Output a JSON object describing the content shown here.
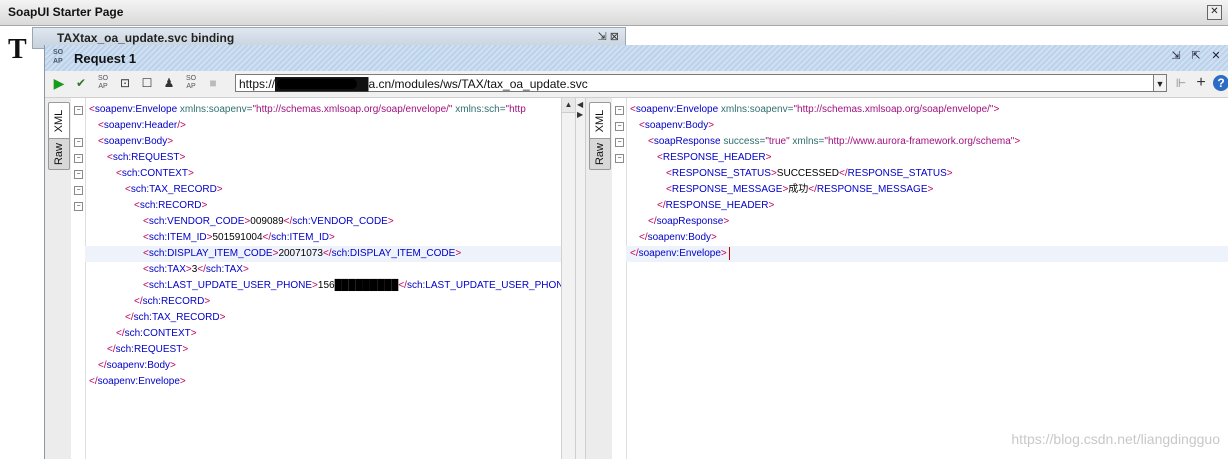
{
  "starter": {
    "title": "SoapUI Starter Page",
    "close": "✕",
    "heading_letter": "T"
  },
  "behind_window": {
    "title": "TAXtax_oa_update.svc binding"
  },
  "request": {
    "title": "Request 1",
    "logo_top": "SO",
    "logo_bottom": "AP",
    "url": "https://███████████a.cn/modules/ws/TAX/tax_oa_update.svc"
  },
  "left_tabs": {
    "xml": "XML",
    "raw": "Raw"
  },
  "right_tabs": {
    "xml": "XML",
    "raw": "Raw"
  },
  "request_lines": [
    {
      "indent": 0,
      "fold": true,
      "parts": [
        [
          "br",
          "<"
        ],
        [
          "tag",
          "soapenv:Envelope"
        ],
        [
          "attr",
          " xmlns:soapenv="
        ],
        [
          "val",
          "\"http://schemas.xmlsoap.org/soap/envelope/\""
        ],
        [
          "attr",
          " xmlns:sch="
        ],
        [
          "val",
          "\"http"
        ]
      ]
    },
    {
      "indent": 1,
      "fold": false,
      "parts": [
        [
          "br",
          "<"
        ],
        [
          "tag",
          "soapenv:Header"
        ],
        [
          "br",
          "/>"
        ]
      ]
    },
    {
      "indent": 1,
      "fold": true,
      "parts": [
        [
          "br",
          "<"
        ],
        [
          "tag",
          "soapenv:Body"
        ],
        [
          "br",
          ">"
        ]
      ]
    },
    {
      "indent": 2,
      "fold": true,
      "parts": [
        [
          "br",
          "<"
        ],
        [
          "tag",
          "sch:REQUEST"
        ],
        [
          "br",
          ">"
        ]
      ]
    },
    {
      "indent": 3,
      "fold": true,
      "parts": [
        [
          "br",
          "<"
        ],
        [
          "tag",
          "sch:CONTEXT"
        ],
        [
          "br",
          ">"
        ]
      ]
    },
    {
      "indent": 4,
      "fold": true,
      "parts": [
        [
          "br",
          "<"
        ],
        [
          "tag",
          "sch:TAX_RECORD"
        ],
        [
          "br",
          ">"
        ]
      ]
    },
    {
      "indent": 5,
      "fold": true,
      "parts": [
        [
          "br",
          "<"
        ],
        [
          "tag",
          "sch:RECORD"
        ],
        [
          "br",
          ">"
        ]
      ]
    },
    {
      "indent": 6,
      "fold": false,
      "parts": [
        [
          "br",
          "<"
        ],
        [
          "tag",
          "sch:VENDOR_CODE"
        ],
        [
          "br",
          ">"
        ],
        [
          "txt",
          "009089"
        ],
        [
          "br",
          "</"
        ],
        [
          "tag",
          "sch:VENDOR_CODE"
        ],
        [
          "br",
          ">"
        ]
      ]
    },
    {
      "indent": 6,
      "fold": false,
      "parts": [
        [
          "br",
          "<"
        ],
        [
          "tag",
          "sch:ITEM_ID"
        ],
        [
          "br",
          ">"
        ],
        [
          "txt",
          "501591004"
        ],
        [
          "br",
          "</"
        ],
        [
          "tag",
          "sch:ITEM_ID"
        ],
        [
          "br",
          ">"
        ]
      ]
    },
    {
      "indent": 6,
      "fold": false,
      "hl": true,
      "parts": [
        [
          "br",
          "<"
        ],
        [
          "tag",
          "sch:DISPLAY_ITEM_CODE"
        ],
        [
          "br",
          ">"
        ],
        [
          "txt",
          "20071073"
        ],
        [
          "br",
          "</"
        ],
        [
          "tag",
          "sch:DISPLAY_ITEM_CODE"
        ],
        [
          "br",
          ">"
        ]
      ]
    },
    {
      "indent": 6,
      "fold": false,
      "parts": [
        [
          "br",
          "<"
        ],
        [
          "tag",
          "sch:TAX"
        ],
        [
          "br",
          ">"
        ],
        [
          "txt",
          "3"
        ],
        [
          "br",
          "</"
        ],
        [
          "tag",
          "sch:TAX"
        ],
        [
          "br",
          ">"
        ]
      ]
    },
    {
      "indent": 6,
      "fold": false,
      "parts": [
        [
          "br",
          "<"
        ],
        [
          "tag",
          "sch:LAST_UPDATE_USER_PHONE"
        ],
        [
          "br",
          ">"
        ],
        [
          "txt",
          "156█████████"
        ],
        [
          "br",
          "</"
        ],
        [
          "tag",
          "sch:LAST_UPDATE_USER_PHONE"
        ],
        [
          "br",
          ">"
        ]
      ]
    },
    {
      "indent": 5,
      "fold": false,
      "parts": [
        [
          "br",
          "</"
        ],
        [
          "tag",
          "sch:RECORD"
        ],
        [
          "br",
          ">"
        ]
      ]
    },
    {
      "indent": 4,
      "fold": false,
      "parts": [
        [
          "br",
          "</"
        ],
        [
          "tag",
          "sch:TAX_RECORD"
        ],
        [
          "br",
          ">"
        ]
      ]
    },
    {
      "indent": 3,
      "fold": false,
      "parts": [
        [
          "br",
          "</"
        ],
        [
          "tag",
          "sch:CONTEXT"
        ],
        [
          "br",
          ">"
        ]
      ]
    },
    {
      "indent": 2,
      "fold": false,
      "parts": [
        [
          "br",
          "</"
        ],
        [
          "tag",
          "sch:REQUEST"
        ],
        [
          "br",
          ">"
        ]
      ]
    },
    {
      "indent": 1,
      "fold": false,
      "parts": [
        [
          "br",
          "</"
        ],
        [
          "tag",
          "soapenv:Body"
        ],
        [
          "br",
          ">"
        ]
      ]
    },
    {
      "indent": 0,
      "fold": false,
      "parts": [
        [
          "br",
          "</"
        ],
        [
          "tag",
          "soapenv:Envelope"
        ],
        [
          "br",
          ">"
        ]
      ]
    }
  ],
  "response_lines": [
    {
      "indent": 0,
      "fold": true,
      "parts": [
        [
          "br",
          "<"
        ],
        [
          "tag",
          "soapenv:Envelope"
        ],
        [
          "attr",
          " xmlns:soapenv="
        ],
        [
          "val",
          "\"http://schemas.xmlsoap.org/soap/envelope/\""
        ],
        [
          "br",
          ">"
        ]
      ]
    },
    {
      "indent": 1,
      "fold": true,
      "parts": [
        [
          "br",
          "<"
        ],
        [
          "tag",
          "soapenv:Body"
        ],
        [
          "br",
          ">"
        ]
      ]
    },
    {
      "indent": 2,
      "fold": true,
      "parts": [
        [
          "br",
          "<"
        ],
        [
          "tag",
          "soapResponse"
        ],
        [
          "attr",
          " success="
        ],
        [
          "val",
          "\"true\""
        ],
        [
          "attr",
          " xmlns="
        ],
        [
          "val",
          "\"http://www.aurora-framework.org/schema\""
        ],
        [
          "br",
          ">"
        ]
      ]
    },
    {
      "indent": 3,
      "fold": true,
      "parts": [
        [
          "br",
          "<"
        ],
        [
          "tag",
          "RESPONSE_HEADER"
        ],
        [
          "br",
          ">"
        ]
      ]
    },
    {
      "indent": 4,
      "fold": false,
      "parts": [
        [
          "br",
          "<"
        ],
        [
          "tag",
          "RESPONSE_STATUS"
        ],
        [
          "br",
          ">"
        ],
        [
          "txt",
          "SUCCESSED"
        ],
        [
          "br",
          "</"
        ],
        [
          "tag",
          "RESPONSE_STATUS"
        ],
        [
          "br",
          ">"
        ]
      ]
    },
    {
      "indent": 4,
      "fold": false,
      "parts": [
        [
          "br",
          "<"
        ],
        [
          "tag",
          "RESPONSE_MESSAGE"
        ],
        [
          "br",
          ">"
        ],
        [
          "txt",
          "成功"
        ],
        [
          "br",
          "</"
        ],
        [
          "tag",
          "RESPONSE_MESSAGE"
        ],
        [
          "br",
          ">"
        ]
      ]
    },
    {
      "indent": 3,
      "fold": false,
      "parts": [
        [
          "br",
          "</"
        ],
        [
          "tag",
          "RESPONSE_HEADER"
        ],
        [
          "br",
          ">"
        ]
      ]
    },
    {
      "indent": 2,
      "fold": false,
      "parts": [
        [
          "br",
          "</"
        ],
        [
          "tag",
          "soapResponse"
        ],
        [
          "br",
          ">"
        ]
      ]
    },
    {
      "indent": 1,
      "fold": false,
      "parts": [
        [
          "br",
          "</"
        ],
        [
          "tag",
          "soapenv:Body"
        ],
        [
          "br",
          ">"
        ]
      ]
    },
    {
      "indent": 0,
      "fold": false,
      "hl": true,
      "parts": [
        [
          "br",
          "</"
        ],
        [
          "tag",
          "soapenv:Envelope"
        ],
        [
          "br",
          ">"
        ]
      ]
    }
  ],
  "watermark": "https://blog.csdn.net/liangdingguo"
}
